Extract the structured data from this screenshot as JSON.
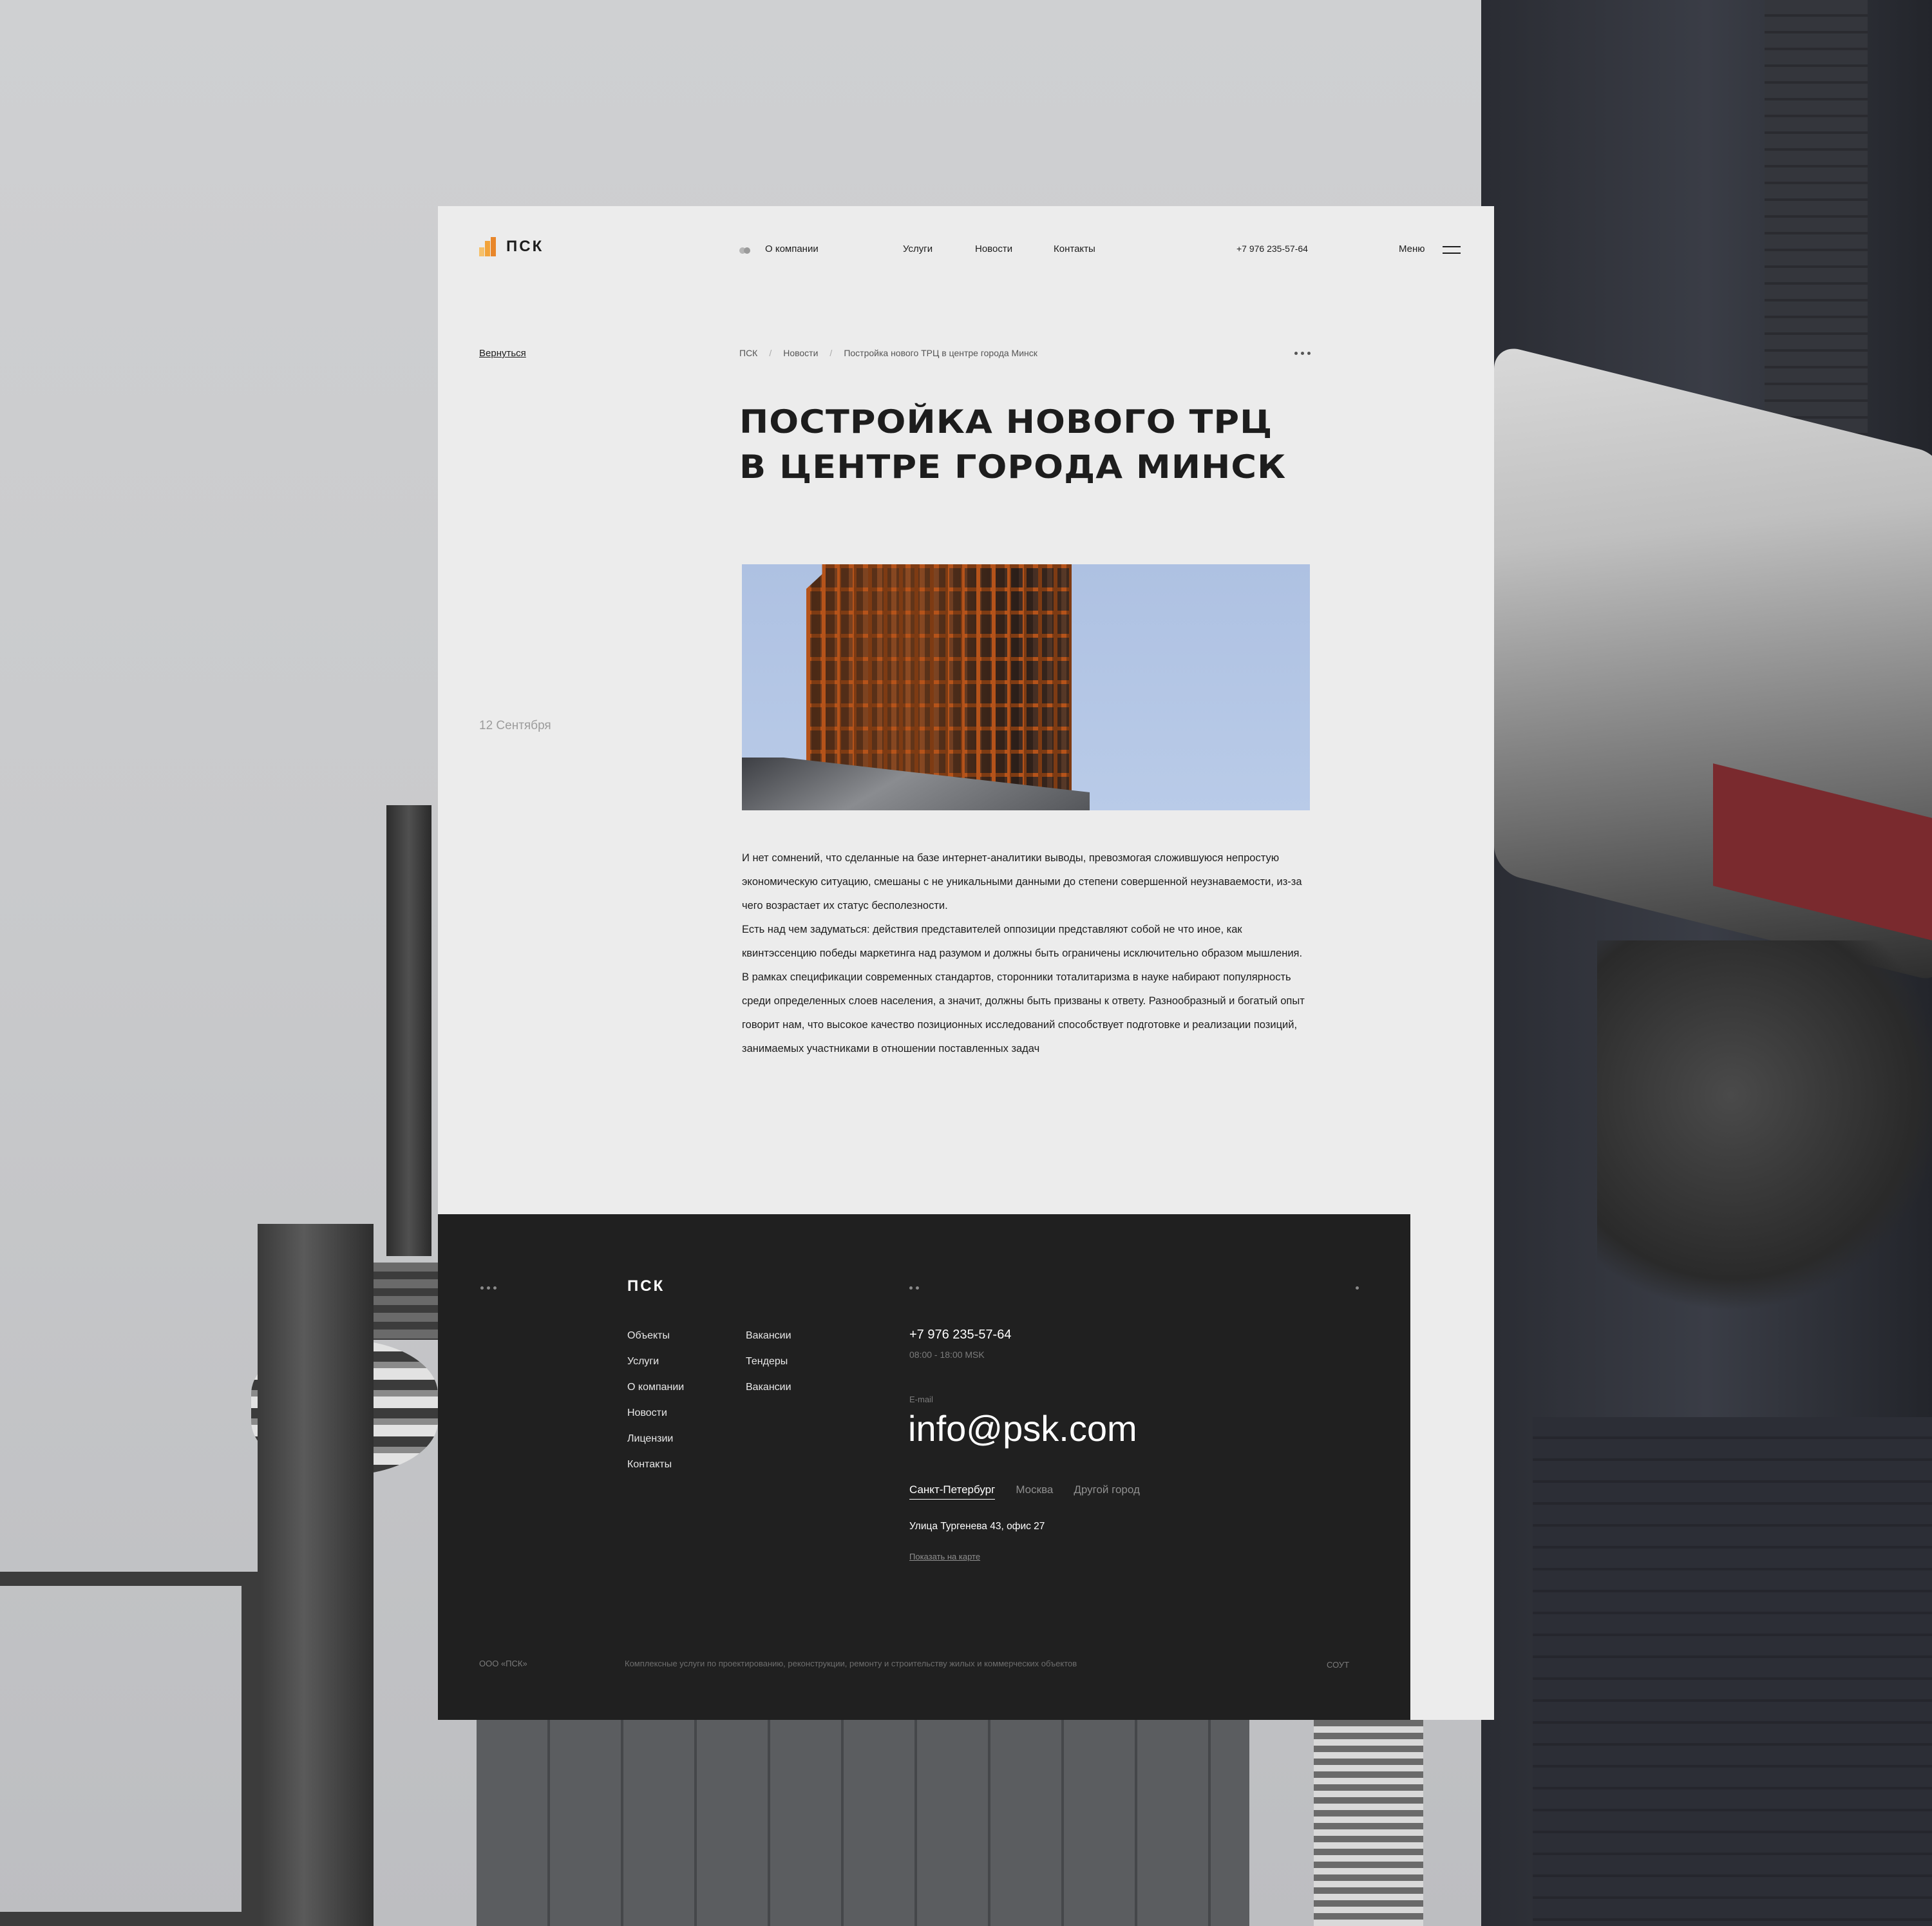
{
  "logo": {
    "text": "ПСК"
  },
  "nav": {
    "items": [
      "О компании",
      "Услуги",
      "Новости",
      "Контакты"
    ],
    "phone": "+7  976  235-57-64",
    "menu_label": "Меню"
  },
  "article": {
    "back_label": "Вернуться",
    "breadcrumb": [
      "ПСК",
      "Новости",
      "Постройка нового ТРЦ в центре города Минск"
    ],
    "breadcrumb_separator": "/",
    "title_line1": "ПОСТРОЙКА НОВОГО ТРЦ",
    "title_line2": "В ЦЕНТРЕ ГОРОДА МИНСК",
    "date": "12 Сентября",
    "paragraph1": "И нет сомнений, что сделанные на базе интернет-аналитики выводы, превозмогая сложившуюся непростую экономическую ситуацию, смешаны с не уникальными данными до степени совершенной неузнаваемости, из-за чего возрастает их статус бесполезности.",
    "paragraph2": "Есть над чем задуматься: действия представителей оппозиции представляют собой не что иное, как квинтэссенцию победы маркетинга над разумом и должны быть ограничены исключительно образом мышления. В рамках спецификации современных стандартов, сторонники тоталитаризма в науке набирают популярность среди определенных слоев населения, а значит, должны быть призваны к ответу. Разнообразный и богатый опыт говорит нам, что высокое качество позиционных исследований способствует подготовке и реализации позиций, занимаемых участниками в отношении поставленных задач"
  },
  "footer": {
    "logo": "ПСК",
    "col1": [
      "Объекты",
      "Услуги",
      "О компании",
      "Новости",
      "Лицензии",
      "Контакты"
    ],
    "col2": [
      "Вакансии",
      "Тендеры",
      "Вакансии"
    ],
    "phone": "+7  976  235-57-64",
    "hours": "08:00 - 18:00 MSK",
    "email_label": "E-mail",
    "email": "info@psk.com",
    "cities": [
      "Санкт-Петербург",
      "Москва",
      "Другой город"
    ],
    "active_city": "Санкт-Петербург",
    "address": "Улица Тургенева 43, офис 27",
    "map_link": "Показать на карте",
    "company": "ООО «ПСК»",
    "description": "Комплексные услуги по проектированию, реконструкции, ремонту и строительству жилых и коммерческих объектов",
    "sout": "СОУТ"
  },
  "colors": {
    "accent": "#f2a33a",
    "footer_bg": "#202020",
    "page_bg": "#ececec"
  }
}
